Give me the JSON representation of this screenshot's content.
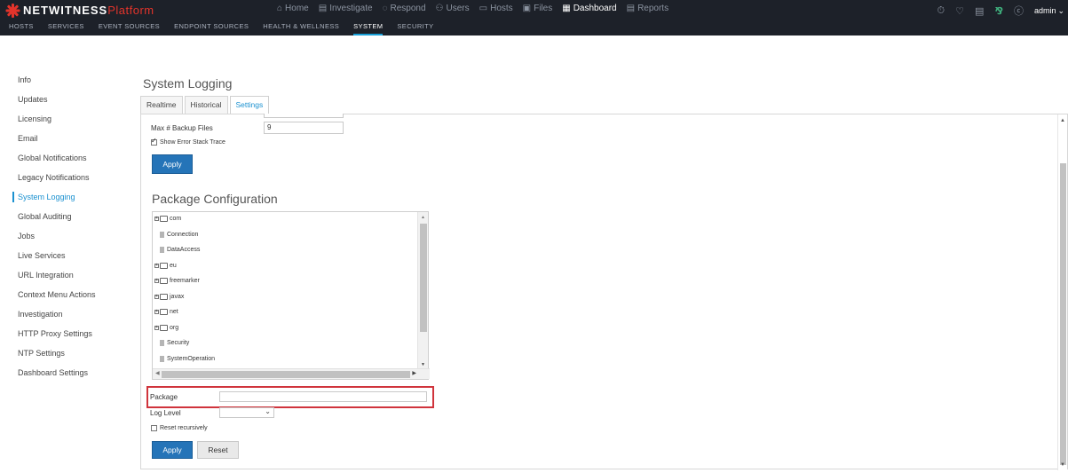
{
  "brand": {
    "name_white": "NETWITNESS",
    "name_red": "Platform"
  },
  "main_nav": [
    {
      "icon": "⌂",
      "icon_name": "home-icon",
      "label": "Home",
      "active": false
    },
    {
      "icon": "▤",
      "icon_name": "investigate-icon",
      "label": "Investigate",
      "active": false
    },
    {
      "icon": "◌",
      "icon_name": "respond-icon",
      "label": "Respond",
      "active": false
    },
    {
      "icon": "⚇",
      "icon_name": "users-icon",
      "label": "Users",
      "active": false
    },
    {
      "icon": "▭",
      "icon_name": "hosts-icon",
      "label": "Hosts",
      "active": false
    },
    {
      "icon": "▣",
      "icon_name": "files-icon",
      "label": "Files",
      "active": false
    },
    {
      "icon": "▦",
      "icon_name": "dashboard-icon",
      "label": "Dashboard",
      "active": true
    },
    {
      "icon": "▤",
      "icon_name": "reports-icon",
      "label": "Reports",
      "active": false
    }
  ],
  "toolbar_icons": {
    "timer": "⏱",
    "bell": "🔔",
    "list": "☰",
    "tools": "✂",
    "help": "?"
  },
  "user": {
    "name": "admin"
  },
  "sub_nav": [
    {
      "label": "HOSTS",
      "active": false
    },
    {
      "label": "SERVICES",
      "active": false
    },
    {
      "label": "EVENT SOURCES",
      "active": false
    },
    {
      "label": "ENDPOINT SOURCES",
      "active": false
    },
    {
      "label": "HEALTH & WELLNESS",
      "active": false
    },
    {
      "label": "SYSTEM",
      "active": true
    },
    {
      "label": "SECURITY",
      "active": false
    }
  ],
  "sidebar": [
    {
      "label": "Info",
      "active": false
    },
    {
      "label": "Updates",
      "active": false
    },
    {
      "label": "Licensing",
      "active": false
    },
    {
      "label": "Email",
      "active": false
    },
    {
      "label": "Global Notifications",
      "active": false
    },
    {
      "label": "Legacy Notifications",
      "active": false
    },
    {
      "label": "System Logging",
      "active": true
    },
    {
      "label": "Global Auditing",
      "active": false
    },
    {
      "label": "Jobs",
      "active": false
    },
    {
      "label": "Live Services",
      "active": false
    },
    {
      "label": "URL Integration",
      "active": false
    },
    {
      "label": "Context Menu Actions",
      "active": false
    },
    {
      "label": "Investigation",
      "active": false
    },
    {
      "label": "HTTP Proxy Settings",
      "active": false
    },
    {
      "label": "NTP Settings",
      "active": false
    },
    {
      "label": "Dashboard Settings",
      "active": false
    }
  ],
  "page": {
    "title": "System Logging",
    "tabs": [
      {
        "label": "Realtime",
        "active": false
      },
      {
        "label": "Historical",
        "active": false
      },
      {
        "label": "Settings",
        "active": true
      }
    ]
  },
  "settings": {
    "max_backup_label": "Max # Backup Files",
    "max_backup_value": "9",
    "show_error_stack_label": "Show Error Stack Trace",
    "show_error_stack_checked": true,
    "apply_label": "Apply"
  },
  "package_config": {
    "title": "Package Configuration",
    "tree": [
      {
        "type": "folder",
        "label": "com",
        "indent": 0
      },
      {
        "type": "file",
        "label": "Connection",
        "indent": 1
      },
      {
        "type": "file",
        "label": "DataAccess",
        "indent": 1
      },
      {
        "type": "folder",
        "label": "eu",
        "indent": 0
      },
      {
        "type": "folder",
        "label": "freemarker",
        "indent": 0
      },
      {
        "type": "folder",
        "label": "javax",
        "indent": 0
      },
      {
        "type": "folder",
        "label": "net",
        "indent": 0
      },
      {
        "type": "folder",
        "label": "org",
        "indent": 0
      },
      {
        "type": "file",
        "label": "Security",
        "indent": 1
      },
      {
        "type": "file",
        "label": "SystemOperation",
        "indent": 1
      }
    ],
    "package_label": "Package",
    "package_value": "",
    "log_level_label": "Log Level",
    "log_level_value": "",
    "reset_recursively_label": "Reset recursively",
    "reset_recursively_checked": false,
    "apply_label": "Apply",
    "reset_label": "Reset"
  },
  "colors": {
    "topbar": "#1d2129",
    "brand_red": "#e3342b",
    "accent_blue": "#1b91d0",
    "button_blue": "#2574b8",
    "highlight_red": "#d0343c"
  }
}
